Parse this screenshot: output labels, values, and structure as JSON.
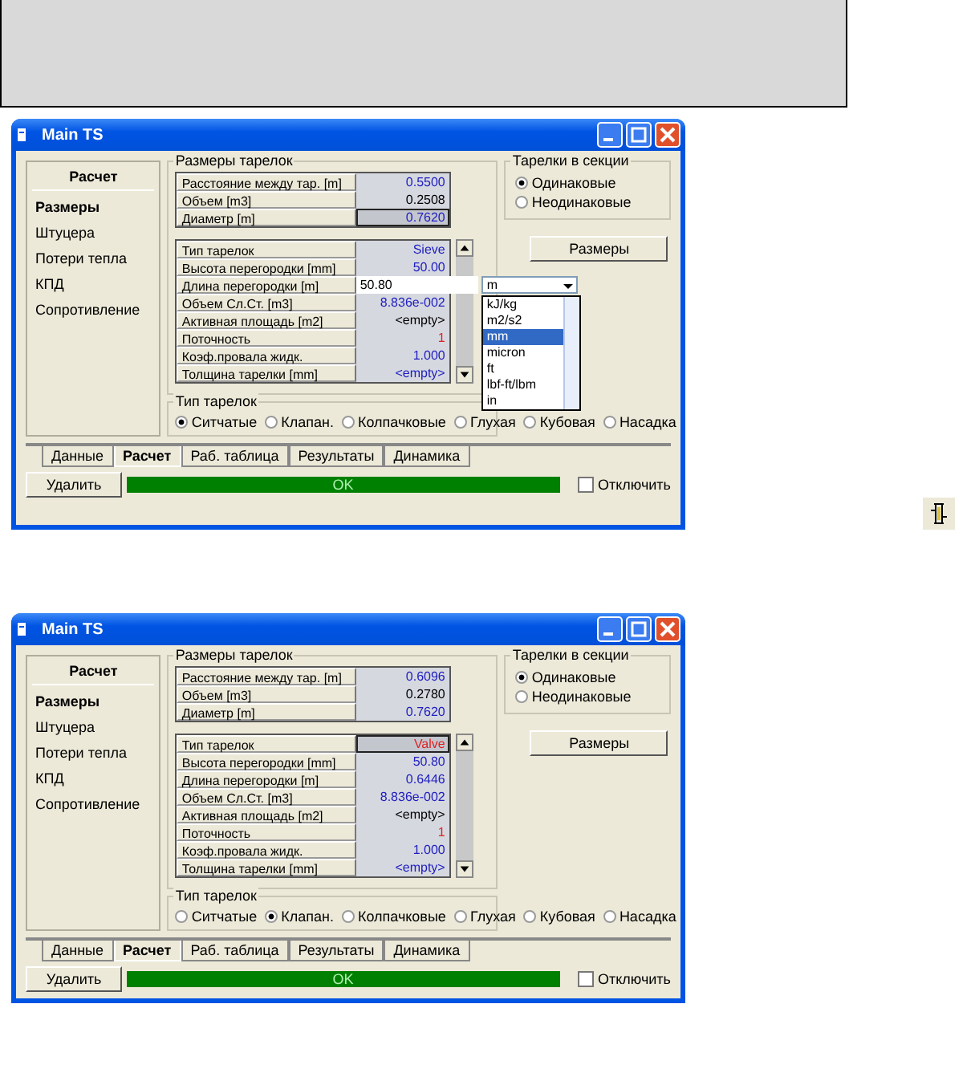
{
  "windows": [
    {
      "title": "Main TS",
      "sidebar": {
        "heading": "Расчет",
        "items": [
          {
            "label": "Размеры",
            "selected": true
          },
          {
            "label": "Штуцера",
            "selected": false
          },
          {
            "label": "Потери тепла",
            "selected": false
          },
          {
            "label": "КПД",
            "selected": false
          },
          {
            "label": "Сопротивление",
            "selected": false
          }
        ]
      },
      "sizes": {
        "legend": "Размеры тарелок",
        "rows": [
          {
            "label": "Расстояние между тар. [m]",
            "value": "0.5500",
            "color": "#2020c0",
            "selected": false
          },
          {
            "label": "Объем [m3]",
            "value": "0.2508",
            "color": "#000000",
            "selected": false
          },
          {
            "label": "Диаметр [m]",
            "value": "0.7620",
            "color": "#2020c0",
            "selected": true
          }
        ]
      },
      "params": [
        {
          "kind": "value",
          "label": "Тип тарелок",
          "value": "Sieve",
          "color": "#2020c0",
          "selected": false
        },
        {
          "kind": "value",
          "label": "Высота перегородки [mm]",
          "value": "50.00",
          "color": "#2020c0",
          "selected": false
        },
        {
          "kind": "edit",
          "label": "Длина перегородки [m]",
          "value": "50.80",
          "unit": "m",
          "options": [
            {
              "label": "kJ/kg",
              "selected": false
            },
            {
              "label": "m2/s2",
              "selected": false
            },
            {
              "label": "mm",
              "selected": true
            },
            {
              "label": "micron",
              "selected": false
            },
            {
              "label": "ft",
              "selected": false
            },
            {
              "label": "lbf-ft/lbm",
              "selected": false
            },
            {
              "label": "in",
              "selected": false
            }
          ]
        },
        {
          "kind": "value",
          "label": "Объем Сл.Ст. [m3]",
          "value": "8.836e-002",
          "color": "#2020c0",
          "selected": false
        },
        {
          "kind": "value",
          "label": "Активная площадь [m2]",
          "value": "<empty>",
          "color": "#000000",
          "selected": false
        },
        {
          "kind": "value",
          "label": "Поточность",
          "value": "1",
          "color": "#e02020",
          "selected": false
        },
        {
          "kind": "value",
          "label": "Коэф.провала жидк.",
          "value": "1.000",
          "color": "#2020c0",
          "selected": false
        },
        {
          "kind": "value",
          "label": "Толщина тарелки [mm]",
          "value": "<empty>",
          "color": "#2020c0",
          "selected": false
        }
      ],
      "section": {
        "legend": "Тарелки в секции",
        "options": [
          {
            "label": "Одинаковые",
            "selected": true
          },
          {
            "label": "Неодинаковые",
            "selected": false
          }
        ],
        "button": "Размеры"
      },
      "tray_type": {
        "legend": "Тип тарелок",
        "options": [
          {
            "label": "Ситчатые",
            "selected": true
          },
          {
            "label": "Клапан.",
            "selected": false
          },
          {
            "label": "Колпачковые",
            "selected": false
          },
          {
            "label": "Глухая",
            "selected": false
          },
          {
            "label": "Кубовая",
            "selected": false
          },
          {
            "label": "Насадка",
            "selected": false
          }
        ]
      },
      "tabs": [
        {
          "label": "Данные",
          "selected": false
        },
        {
          "label": "Расчет",
          "selected": true
        },
        {
          "label": "Раб. таблица",
          "selected": false
        },
        {
          "label": "Результаты",
          "selected": false
        },
        {
          "label": "Динамика",
          "selected": false
        }
      ],
      "delete_button": "Удалить",
      "status": "OK",
      "disable": {
        "label": "Отключить",
        "checked": false
      }
    },
    {
      "title": "Main TS",
      "sidebar": {
        "heading": "Расчет",
        "items": [
          {
            "label": "Размеры",
            "selected": true
          },
          {
            "label": "Штуцера",
            "selected": false
          },
          {
            "label": "Потери тепла",
            "selected": false
          },
          {
            "label": "КПД",
            "selected": false
          },
          {
            "label": "Сопротивление",
            "selected": false
          }
        ]
      },
      "sizes": {
        "legend": "Размеры тарелок",
        "rows": [
          {
            "label": "Расстояние между тар. [m]",
            "value": "0.6096",
            "color": "#2020c0",
            "selected": false
          },
          {
            "label": "Объем [m3]",
            "value": "0.2780",
            "color": "#000000",
            "selected": false
          },
          {
            "label": "Диаметр [m]",
            "value": "0.7620",
            "color": "#2020c0",
            "selected": false
          }
        ]
      },
      "params": [
        {
          "kind": "value",
          "label": "Тип тарелок",
          "value": "Valve",
          "color": "#e02020",
          "selected": true
        },
        {
          "kind": "value",
          "label": "Высота перегородки [mm]",
          "value": "50.80",
          "color": "#2020c0",
          "selected": false
        },
        {
          "kind": "value",
          "label": "Длина перегородки [m]",
          "value": "0.6446",
          "color": "#2020c0",
          "selected": false
        },
        {
          "kind": "value",
          "label": "Объем Сл.Ст. [m3]",
          "value": "8.836e-002",
          "color": "#2020c0",
          "selected": false
        },
        {
          "kind": "value",
          "label": "Активная площадь [m2]",
          "value": "<empty>",
          "color": "#000000",
          "selected": false
        },
        {
          "kind": "value",
          "label": "Поточность",
          "value": "1",
          "color": "#e02020",
          "selected": false
        },
        {
          "kind": "value",
          "label": "Коэф.провала жидк.",
          "value": "1.000",
          "color": "#2020c0",
          "selected": false
        },
        {
          "kind": "value",
          "label": "Толщина тарелки [mm]",
          "value": "<empty>",
          "color": "#2020c0",
          "selected": false
        }
      ],
      "section": {
        "legend": "Тарелки в секции",
        "options": [
          {
            "label": "Одинаковые",
            "selected": true
          },
          {
            "label": "Неодинаковые",
            "selected": false
          }
        ],
        "button": "Размеры"
      },
      "tray_type": {
        "legend": "Тип тарелок",
        "options": [
          {
            "label": "Ситчатые",
            "selected": false
          },
          {
            "label": "Клапан.",
            "selected": true
          },
          {
            "label": "Колпачковые",
            "selected": false
          },
          {
            "label": "Глухая",
            "selected": false
          },
          {
            "label": "Кубовая",
            "selected": false
          },
          {
            "label": "Насадка",
            "selected": false
          }
        ]
      },
      "tabs": [
        {
          "label": "Данные",
          "selected": false
        },
        {
          "label": "Расчет",
          "selected": true
        },
        {
          "label": "Раб. таблица",
          "selected": false
        },
        {
          "label": "Результаты",
          "selected": false
        },
        {
          "label": "Динамика",
          "selected": false
        }
      ],
      "delete_button": "Удалить",
      "status": "OK",
      "disable": {
        "label": "Отключить",
        "checked": false
      }
    }
  ]
}
